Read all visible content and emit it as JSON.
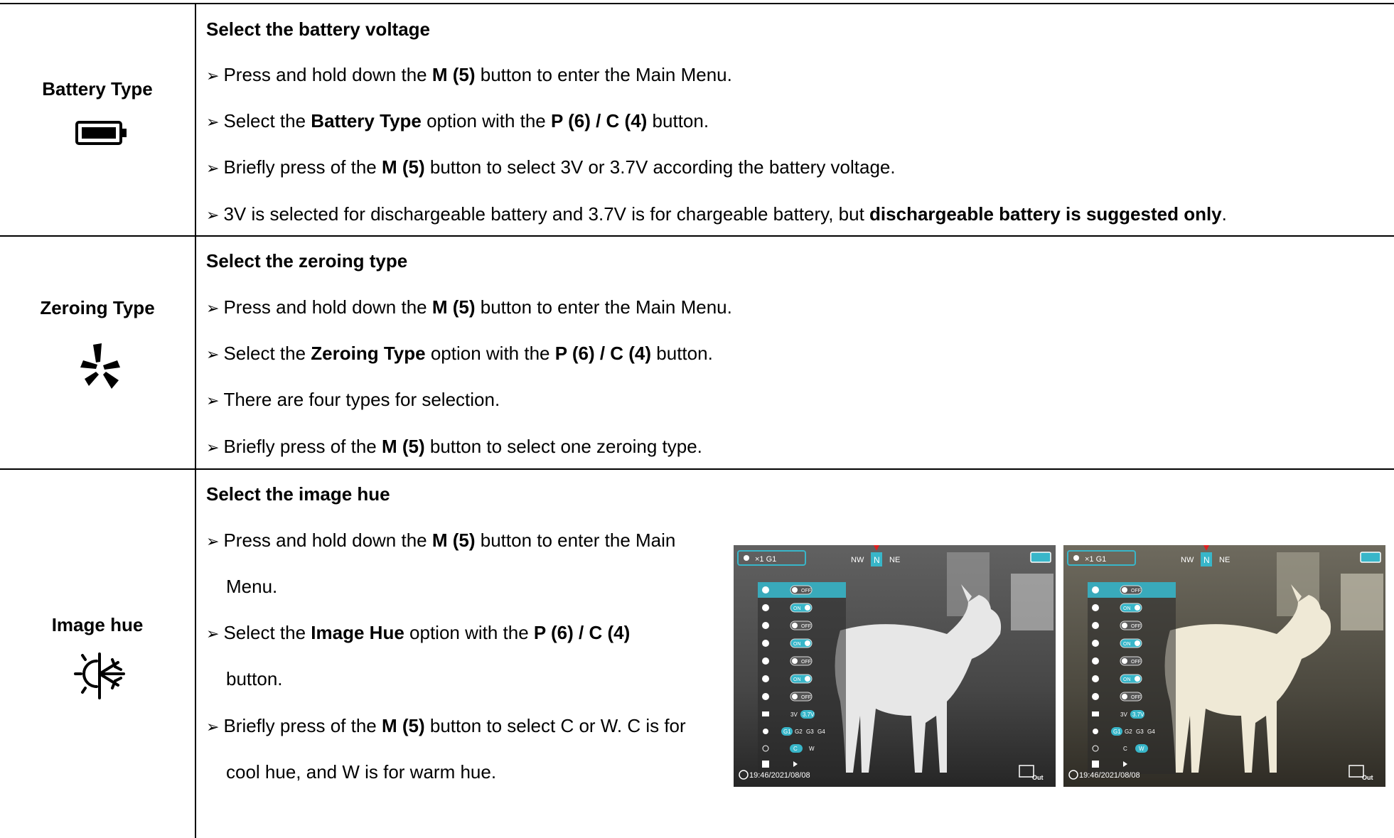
{
  "rows": {
    "battery": {
      "label": "Battery Type",
      "icon": "battery-icon",
      "title": "Select the battery voltage",
      "l1": {
        "a": "Press and hold down the ",
        "b": "M (5)",
        "c": " button to enter the Main Menu."
      },
      "l2": {
        "a": "Select the ",
        "b": "Battery Type",
        "c": " option with the ",
        "d": "P (6) / C (4)",
        "e": " button."
      },
      "l3": {
        "a": "Briefly press of the ",
        "b": "M (5)",
        "c": " button to select 3V or 3.7V according the battery voltage."
      },
      "l4": {
        "a": "3V is selected for dischargeable battery and 3.7V is for chargeable battery, but ",
        "b": "dischargeable battery is suggested only",
        "c": "."
      }
    },
    "zeroing": {
      "label": "Zeroing Type",
      "icon": "zeroing-icon",
      "title": "Select the zeroing type",
      "l1": {
        "a": "Press and hold down the ",
        "b": "M (5)",
        "c": " button to enter the Main Menu."
      },
      "l2": {
        "a": "Select the ",
        "b": "Zeroing Type",
        "c": " option with the ",
        "d": "P (6) / C (4)",
        "e": " button."
      },
      "l3": {
        "a": "There are four types for selection."
      },
      "l4": {
        "a": "Briefly press of the ",
        "b": "M (5)",
        "c": " button to select one zeroing type."
      }
    },
    "hue": {
      "label": "Image hue",
      "icon": "image-hue-icon",
      "title": "Select the image hue",
      "l1": {
        "a": "Press and hold down the ",
        "b": "M (5)",
        "c": " button to enter the Main",
        "cont": "Menu."
      },
      "l2": {
        "a": "Select the ",
        "b": "Image Hue",
        "c": " option with the ",
        "d": "P (6) / C (4)",
        "cont": "button."
      },
      "l3": {
        "a": "Briefly press of the ",
        "b": "M (5)",
        "c": " button to select C or W. C is for",
        "cont": "cool hue, and W is for warm hue."
      }
    }
  },
  "screenshots": [
    {
      "status": "×1  G1",
      "compass": [
        "NW",
        "N",
        "NE"
      ],
      "time": "19:46/2021/08/08",
      "out": "Out",
      "menu": {
        "toggles": [
          "OFF",
          "ON",
          "OFF",
          "ON",
          "OFF",
          "ON",
          "OFF"
        ],
        "battery": [
          "3V",
          "3.7V"
        ],
        "zeroing": [
          "G1",
          "G2",
          "G3",
          "G4"
        ],
        "hue": [
          "C",
          "W"
        ]
      },
      "selected_hue": "C"
    },
    {
      "status": "×1  G1",
      "compass": [
        "NW",
        "N",
        "NE"
      ],
      "time": "19:46/2021/08/08",
      "out": "Out",
      "menu": {
        "toggles": [
          "OFF",
          "ON",
          "OFF",
          "ON",
          "OFF",
          "ON",
          "OFF"
        ],
        "battery": [
          "3V",
          "3.7V"
        ],
        "zeroing": [
          "G1",
          "G2",
          "G3",
          "G4"
        ],
        "hue": [
          "C",
          "W"
        ]
      },
      "selected_hue": "W"
    }
  ],
  "colors": {
    "accent": "#38b6c9",
    "compass_marker": "#e02020"
  }
}
